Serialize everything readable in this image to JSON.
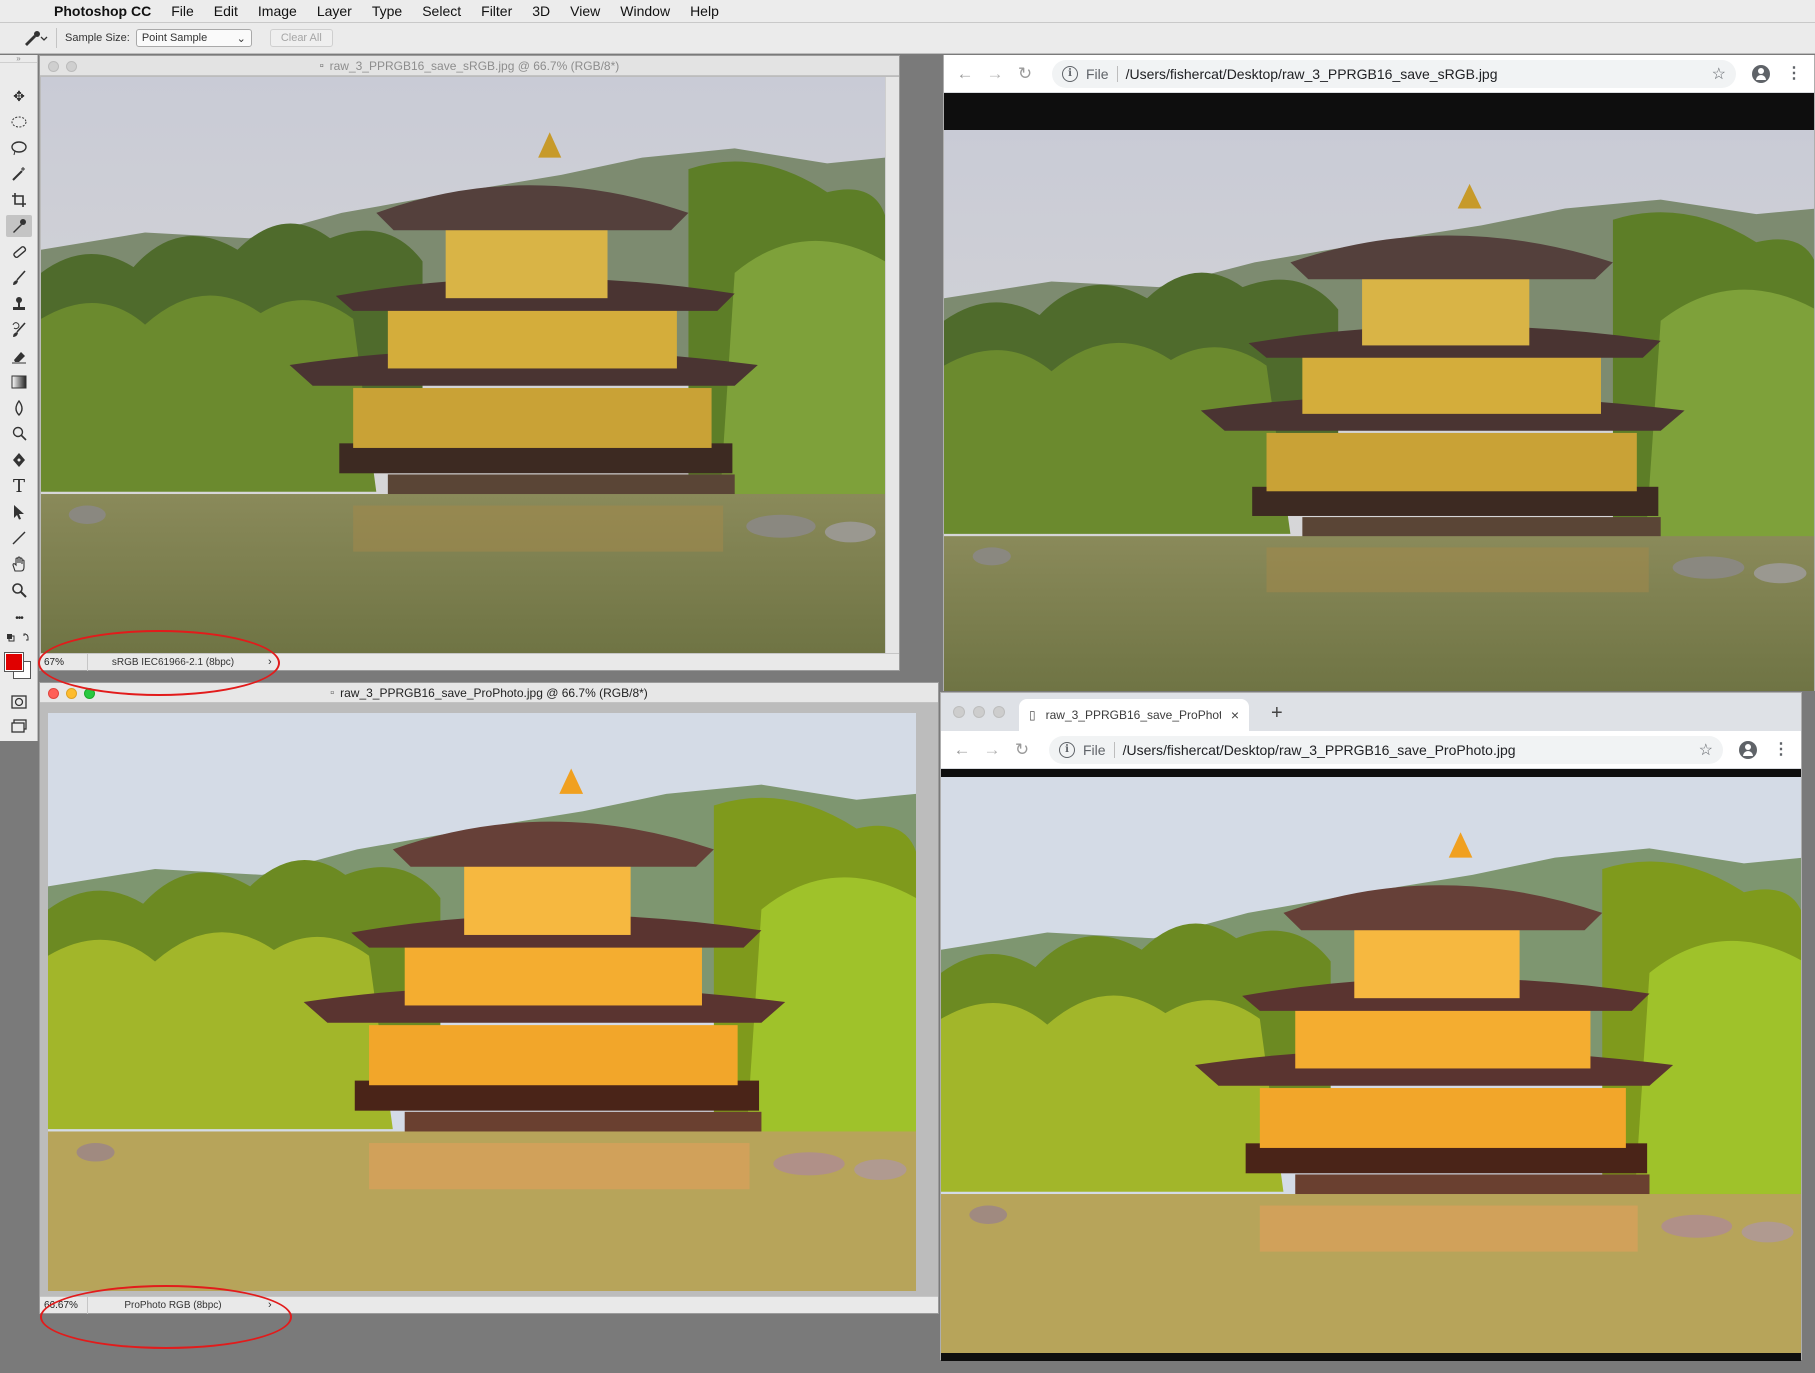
{
  "menubar": {
    "app_name": "Photoshop CC",
    "items": [
      "File",
      "Edit",
      "Image",
      "Layer",
      "Type",
      "Select",
      "Filter",
      "3D",
      "View",
      "Window",
      "Help"
    ]
  },
  "options_bar": {
    "sample_size_label": "Sample Size:",
    "sample_size_value": "Point Sample",
    "clear_all_label": "Clear All"
  },
  "toolbox": {
    "tools": [
      "move-tool",
      "marquee-tool",
      "lasso-tool",
      "magic-wand-tool",
      "crop-tool",
      "eyedropper-tool",
      "healing-tool",
      "brush-tool",
      "stamp-tool",
      "history-brush-tool",
      "eraser-tool",
      "gradient-tool",
      "blur-tool",
      "dodge-tool",
      "pen-tool",
      "type-tool",
      "path-select-tool",
      "line-tool",
      "hand-tool",
      "zoom-tool",
      "more-tools"
    ],
    "type_tool_glyph": "T",
    "more_glyph": "•••",
    "foreground_color": "#e00000",
    "background_color": "#ffffff"
  },
  "ps_doc_srgb": {
    "title": "raw_3_PPRGB16_save_sRGB.jpg @ 66.7% (RGB/8*)",
    "zoom": "67%",
    "profile": "sRGB IEC61966-2.1 (8bpc)",
    "arrow": "›"
  },
  "ps_doc_prophoto": {
    "title": "raw_3_PPRGB16_save_ProPhoto.jpg @ 66.7% (RGB/8*)",
    "zoom": "66.67%",
    "profile": "ProPhoto RGB (8bpc)",
    "arrow": "›"
  },
  "chrome_srgb": {
    "scheme": "File",
    "url": "/Users/fishercat/Desktop/raw_3_PPRGB16_save_sRGB.jpg"
  },
  "chrome_prophoto": {
    "tab_title": "raw_3_PPRGB16_save_ProPhot",
    "tab_close": "×",
    "new_tab": "+",
    "scheme": "File",
    "url": "/Users/fishercat/Desktop/raw_3_PPRGB16_save_ProPhoto.jpg"
  },
  "icons": {
    "back": "←",
    "forward": "→",
    "reload": "↻",
    "info": "i",
    "star": "☆",
    "menu": "⋮"
  },
  "annotation_color": "#e21b1b"
}
